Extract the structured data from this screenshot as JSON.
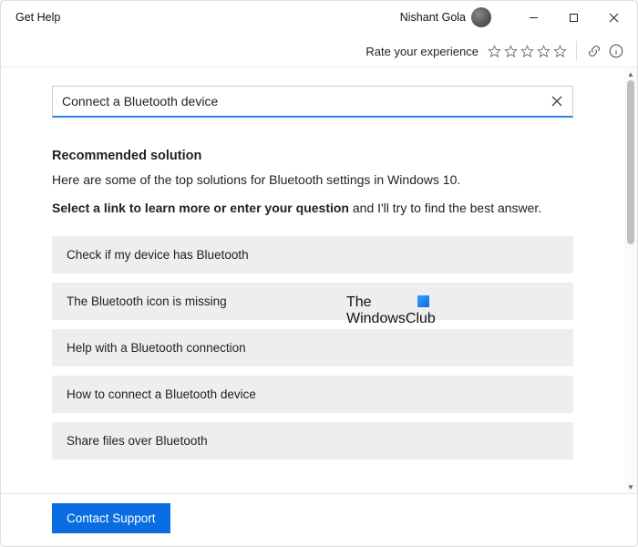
{
  "app": {
    "title": "Get Help"
  },
  "user": {
    "name": "Nishant Gola"
  },
  "rating": {
    "label": "Rate your experience"
  },
  "search": {
    "value": "Connect a Bluetooth device"
  },
  "solution": {
    "heading": "Recommended solution",
    "intro": "Here are some of the top solutions for Bluetooth settings in Windows 10.",
    "instruct_bold": "Select a link to learn more or enter your question",
    "instruct_rest": " and I'll try to find the best answer.",
    "options": [
      "Check if my device has Bluetooth",
      "The Bluetooth icon is missing",
      "Help with a Bluetooth connection",
      "How to connect a Bluetooth device",
      "Share files over Bluetooth"
    ]
  },
  "footer": {
    "contact_label": "Contact Support"
  },
  "watermark": {
    "line1": "The",
    "line2": "WindowsClub"
  }
}
